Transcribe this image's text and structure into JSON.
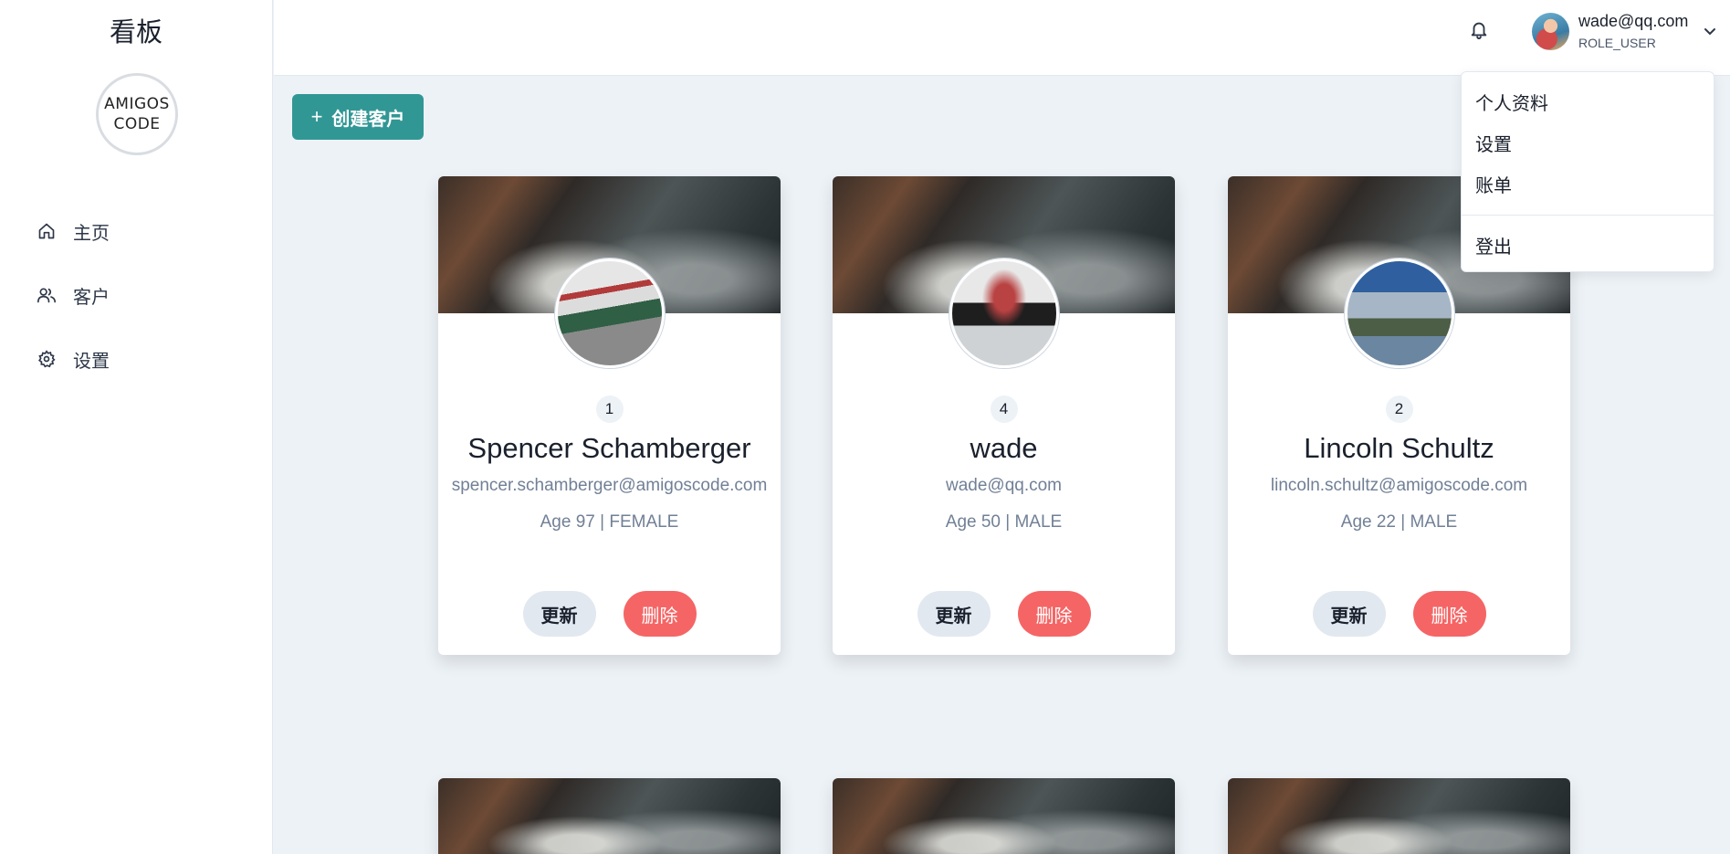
{
  "sidebar": {
    "brand": "看板",
    "logo_line1": "AMIGOS",
    "logo_line2": "CODE",
    "items": [
      {
        "label": "主页",
        "icon": "home-icon"
      },
      {
        "label": "客户",
        "icon": "users-icon"
      },
      {
        "label": "设置",
        "icon": "gear-icon"
      }
    ]
  },
  "header": {
    "user_email": "wade@qq.com",
    "user_role": "ROLE_USER"
  },
  "toolbar": {
    "create_label": "创建客户",
    "create_icon": "+"
  },
  "cards": [
    {
      "id": "1",
      "name": "Spencer Schamberger",
      "email": "spencer.schamberger@amigoscode.com",
      "meta": "Age 97 | FEMALE",
      "update_label": "更新",
      "delete_label": "删除"
    },
    {
      "id": "4",
      "name": "wade",
      "email": "wade@qq.com",
      "meta": "Age 50 | MALE",
      "update_label": "更新",
      "delete_label": "删除"
    },
    {
      "id": "2",
      "name": "Lincoln Schultz",
      "email": "lincoln.schultz@amigoscode.com",
      "meta": "Age 22 | MALE",
      "update_label": "更新",
      "delete_label": "删除"
    }
  ],
  "user_menu": {
    "items": [
      "个人资料",
      "设置",
      "账单"
    ],
    "logout": "登出"
  },
  "colors": {
    "accent": "#319795",
    "danger": "#f56565",
    "background": "#edf2f7"
  }
}
